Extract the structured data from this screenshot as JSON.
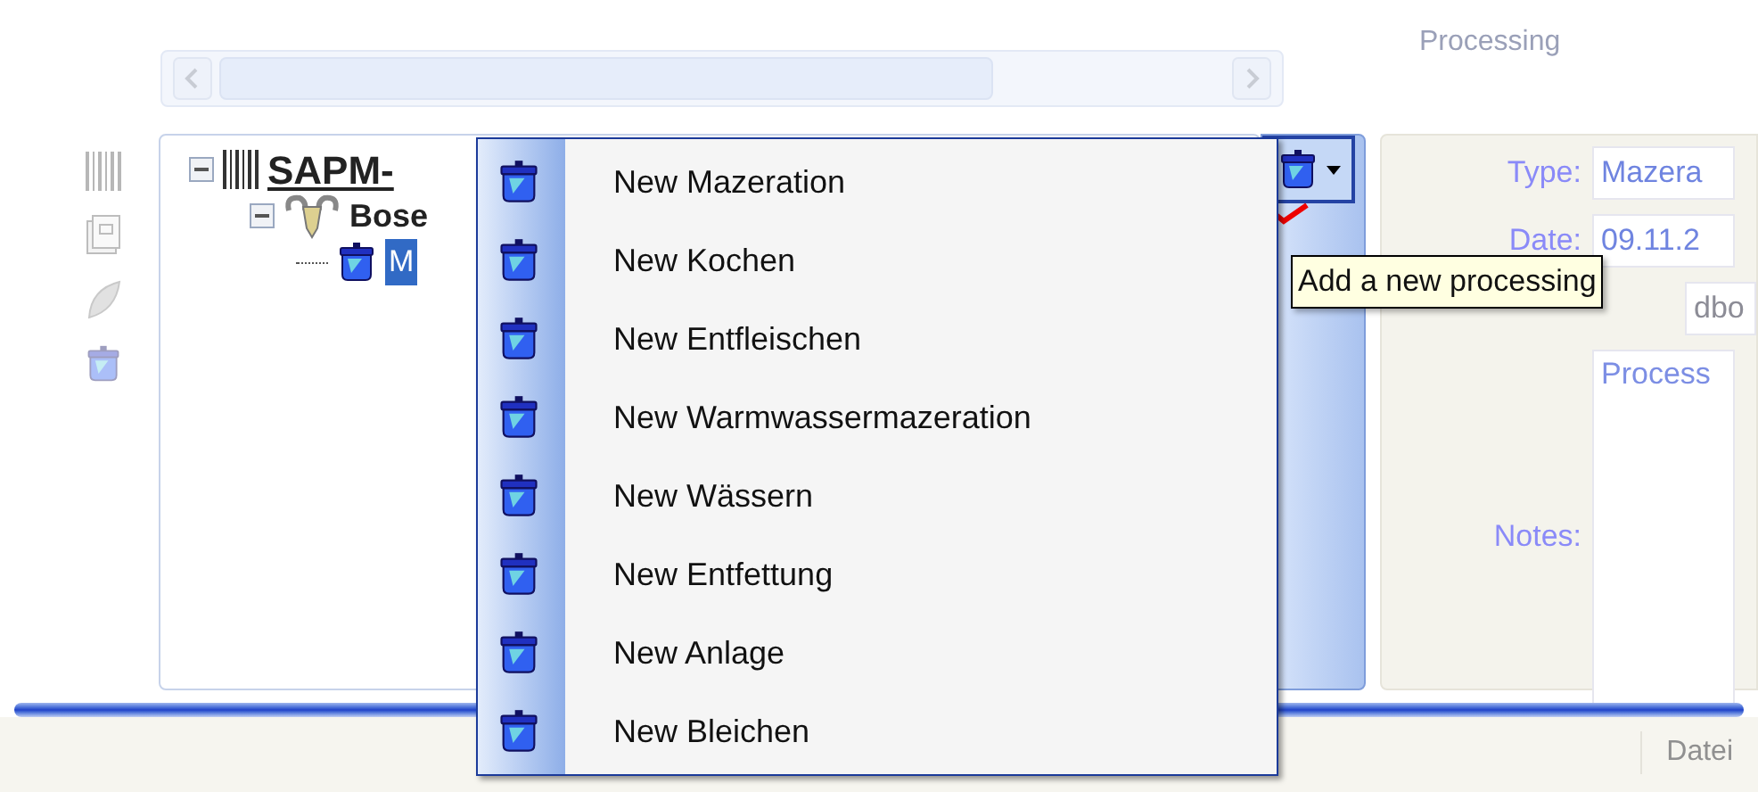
{
  "tree": {
    "items": [
      {
        "label": "SAPM-",
        "kind": "barcode",
        "expanded": true,
        "selected": false,
        "children": [
          {
            "label": "Bose",
            "kind": "animal",
            "expanded": true,
            "selected": false,
            "children": [
              {
                "label": "M",
                "kind": "pot",
                "selected": true
              }
            ]
          }
        ]
      }
    ]
  },
  "menu": {
    "items": [
      {
        "label": "New Mazeration"
      },
      {
        "label": "New Kochen"
      },
      {
        "label": "New Entfleischen"
      },
      {
        "label": "New Warmwassermazeration"
      },
      {
        "label": "New Wässern"
      },
      {
        "label": "New Entfettung"
      },
      {
        "label": "New Anlage"
      },
      {
        "label": "New Bleichen"
      }
    ]
  },
  "tooltip": "Add a new processing",
  "form": {
    "title": "Processing",
    "rows": [
      {
        "kind": "field",
        "label": "Type:",
        "value": "Mazera"
      },
      {
        "kind": "field",
        "label": "Date:",
        "value": "09.11.2"
      },
      {
        "kind": "pair",
        "value": "dbo"
      },
      {
        "kind": "notes",
        "label": "Notes:",
        "value": "Process"
      }
    ]
  },
  "status_bar": {
    "text": "Datei"
  }
}
